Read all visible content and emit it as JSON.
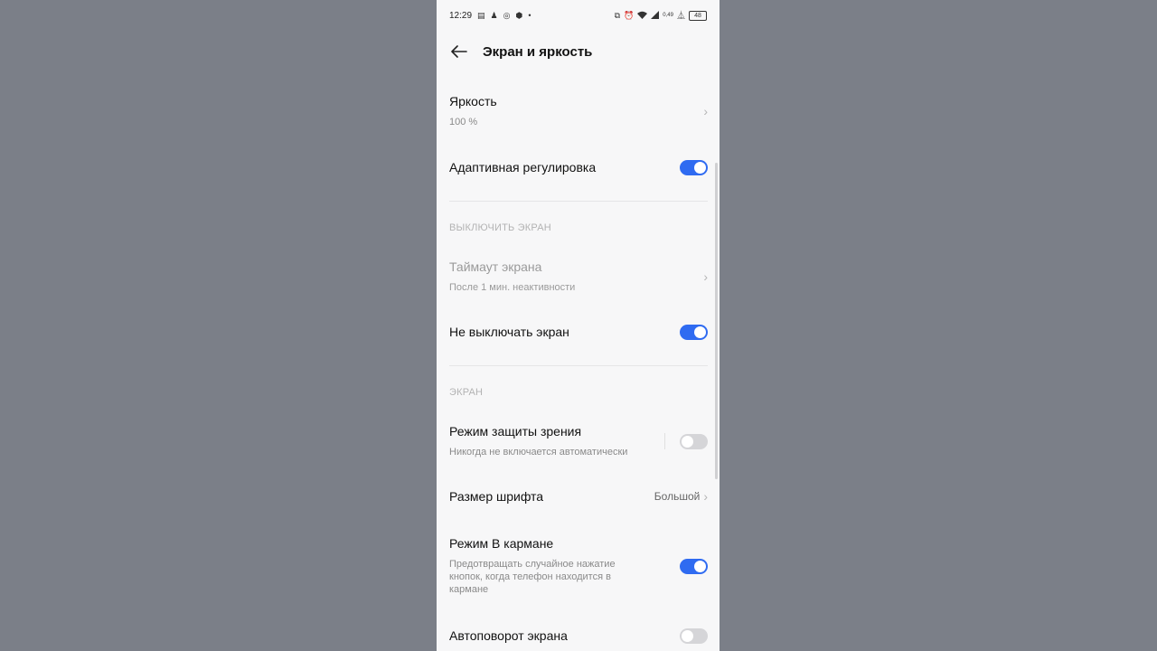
{
  "status_bar": {
    "time": "12:29",
    "left_icons": [
      "message-icon",
      "snapchat-icon",
      "viber-icon",
      "vpn-icon",
      "dot-icon"
    ],
    "right_icons": [
      "cast-icon",
      "alarm-icon",
      "wifi-icon",
      "signal-icon",
      "speed-icon",
      "battery-icon"
    ],
    "network_speed": "0,49",
    "battery": "48"
  },
  "header": {
    "title": "Экран и яркость"
  },
  "brightness": {
    "label": "Яркость",
    "value": "100 %"
  },
  "adaptive": {
    "label": "Адаптивная регулировка",
    "enabled": true
  },
  "section_screen_off": "ВЫКЛЮЧИТЬ ЭКРАН",
  "timeout": {
    "label": "Таймаут экрана",
    "value": "После 1 мин. неактивности"
  },
  "keep_screen_on": {
    "label": "Не выключать экран",
    "enabled": true
  },
  "section_screen": "ЭКРАН",
  "eye_protection": {
    "label": "Режим защиты зрения",
    "value": "Никогда не включается автоматически",
    "enabled": false
  },
  "font_size": {
    "label": "Размер шрифта",
    "value": "Большой"
  },
  "pocket_mode": {
    "label": "Режим В кармане",
    "value": "Предотвращать случайное нажатие кнопок, когда телефон находится в кармане",
    "enabled": true
  },
  "auto_rotate": {
    "label": "Автоповорот экрана",
    "enabled": false
  },
  "colors": {
    "accent": "#2f6bf1",
    "toggle_off": "#d5d5d8",
    "background": "#f7f7f8",
    "outer": "#7b7f88"
  }
}
